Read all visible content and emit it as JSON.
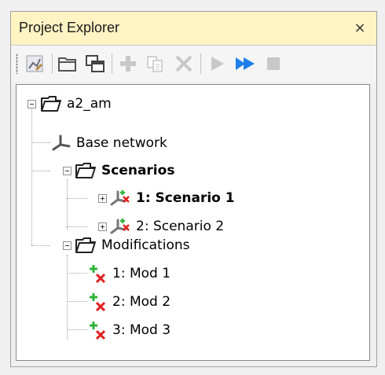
{
  "panel": {
    "title": "Project Explorer",
    "close_glyph": "×"
  },
  "toolbar": {
    "buttons": [
      {
        "icon": "edit-network-icon"
      },
      {
        "icon": "open-folder-icon"
      },
      {
        "icon": "copy-window-icon"
      },
      {
        "icon": "add-plus-icon"
      },
      {
        "icon": "copy-document-icon"
      },
      {
        "icon": "delete-x-icon"
      },
      {
        "icon": "play-icon"
      },
      {
        "icon": "fast-forward-icon"
      },
      {
        "icon": "stop-icon"
      }
    ]
  },
  "tree": {
    "root": {
      "label": "a2_am",
      "icon": "folder-icon",
      "expanded": true
    },
    "base_network": {
      "label": "Base network",
      "icon": "network-icon"
    },
    "scenarios": {
      "label": "Scenarios",
      "icon": "folder-icon",
      "expanded": true,
      "items": [
        {
          "label": "1: Scenario 1",
          "icon": "scenario-network-icon",
          "active": true,
          "expanded": false
        },
        {
          "label": "2: Scenario 2",
          "icon": "scenario-network-icon",
          "active": false,
          "expanded": false
        }
      ]
    },
    "modifications": {
      "label": "Modifications",
      "icon": "folder-icon",
      "expanded": true,
      "items": [
        {
          "label": "1: Mod 1",
          "icon": "modification-icon"
        },
        {
          "label": "2: Mod 2",
          "icon": "modification-icon"
        },
        {
          "label": "3: Mod 3",
          "icon": "modification-icon"
        }
      ]
    }
  },
  "colors": {
    "title_bar": "#fff3c4",
    "accent_blue": "#1e7fe8",
    "add_green": "#2db33a",
    "remove_red": "#e02020"
  }
}
